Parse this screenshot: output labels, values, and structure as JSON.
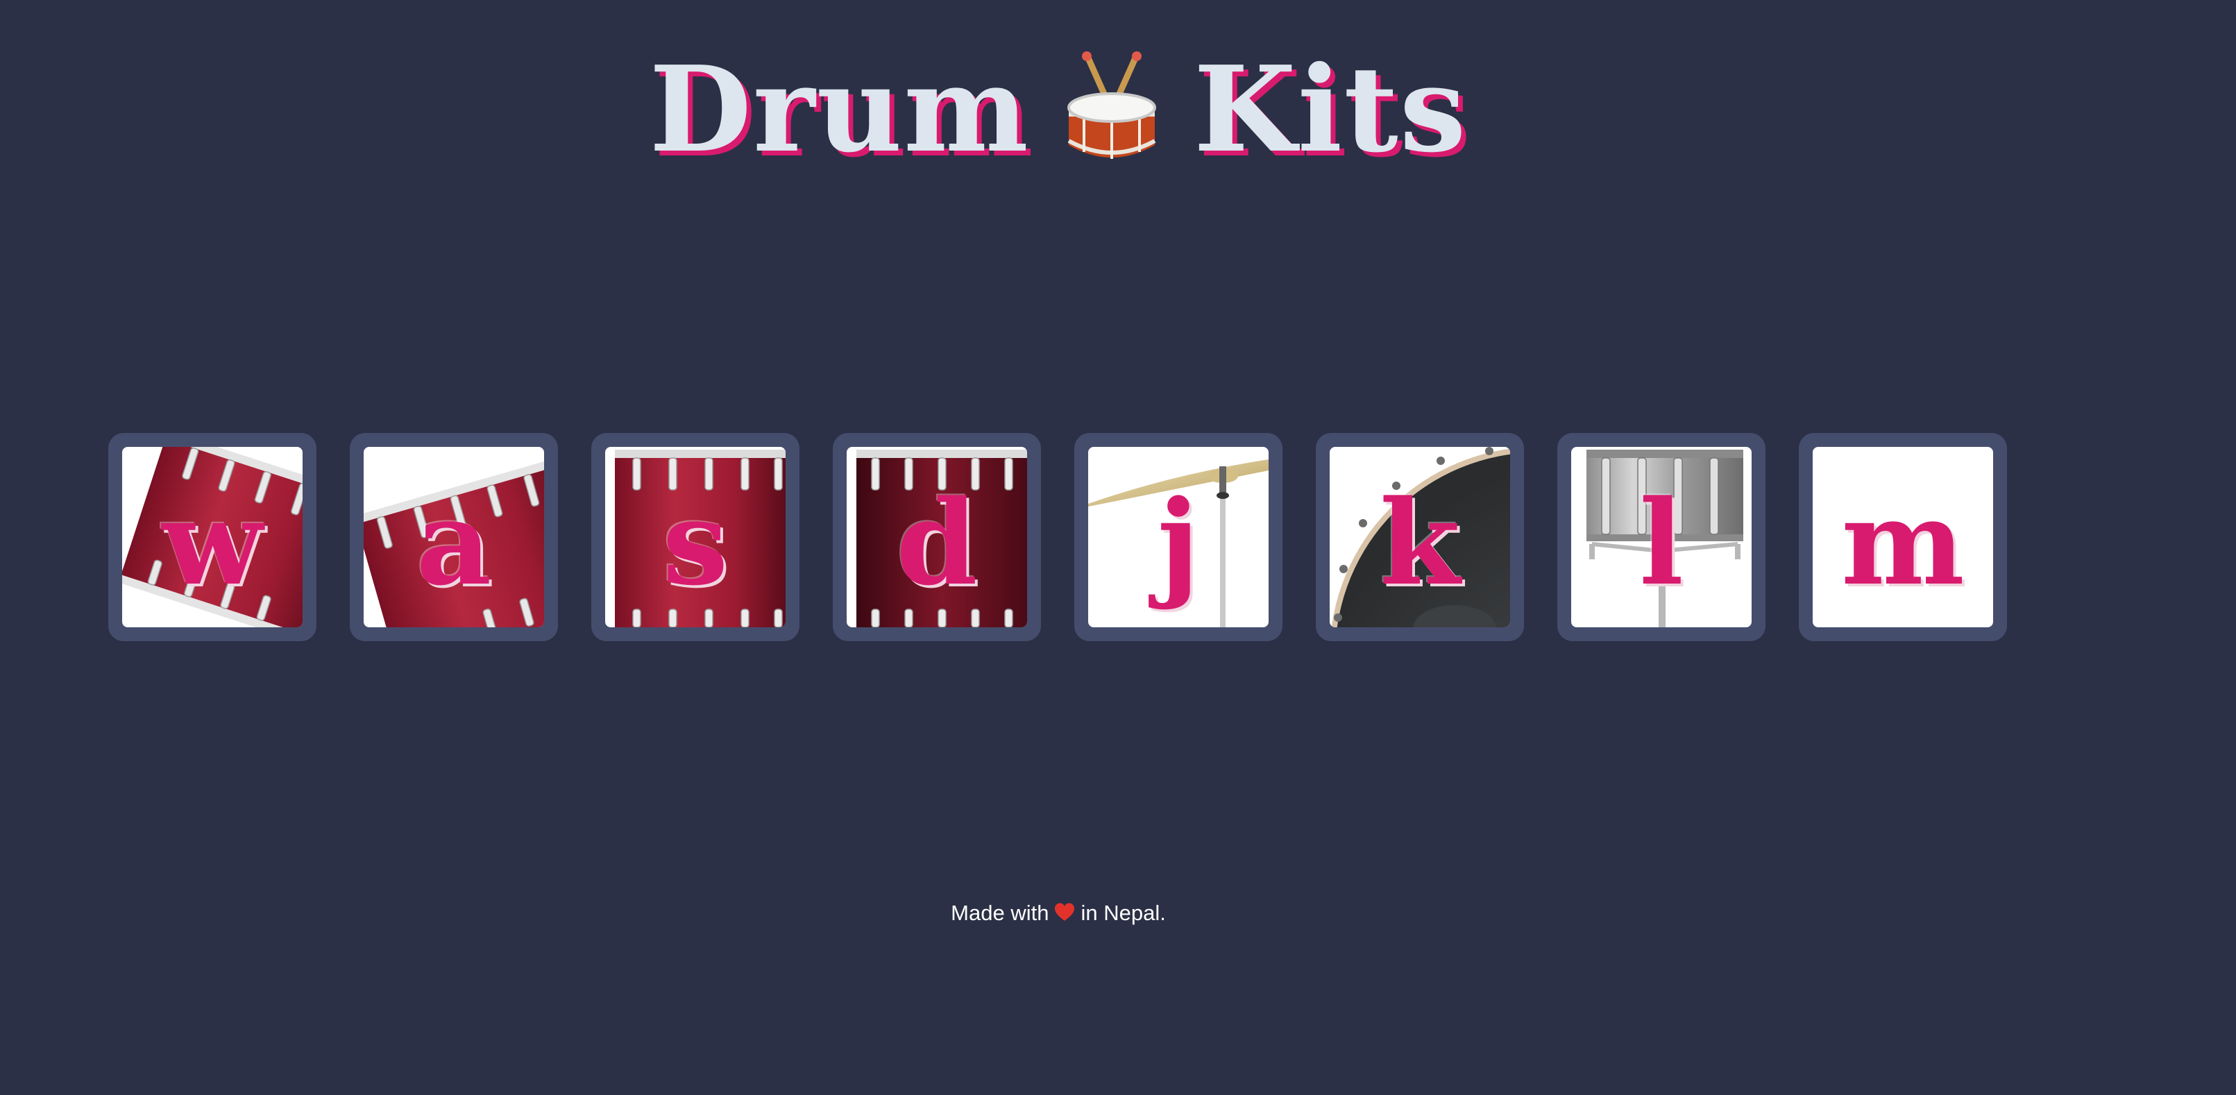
{
  "header": {
    "title_left": "Drum",
    "title_right": "Kits",
    "title_icon": "drum-emoji"
  },
  "drums": [
    {
      "key": "w",
      "instrument_icon": "tom-drum-tilted-left"
    },
    {
      "key": "a",
      "instrument_icon": "tom-drum-tilted-right"
    },
    {
      "key": "s",
      "instrument_icon": "tom-drum"
    },
    {
      "key": "d",
      "instrument_icon": "tom-drum-dark"
    },
    {
      "key": "j",
      "instrument_icon": "cymbal"
    },
    {
      "key": "k",
      "instrument_icon": "bass-drum"
    },
    {
      "key": "l",
      "instrument_icon": "snare-on-stand"
    },
    {
      "key": "m",
      "instrument_icon": "blank"
    }
  ],
  "footer": {
    "before": "Made with",
    "after": "in Nepal.",
    "icon": "heart-icon"
  },
  "colors": {
    "background": "#2b3046",
    "tile": "#454d6d",
    "accent": "#d81b6e",
    "title": "#dde6ee"
  }
}
